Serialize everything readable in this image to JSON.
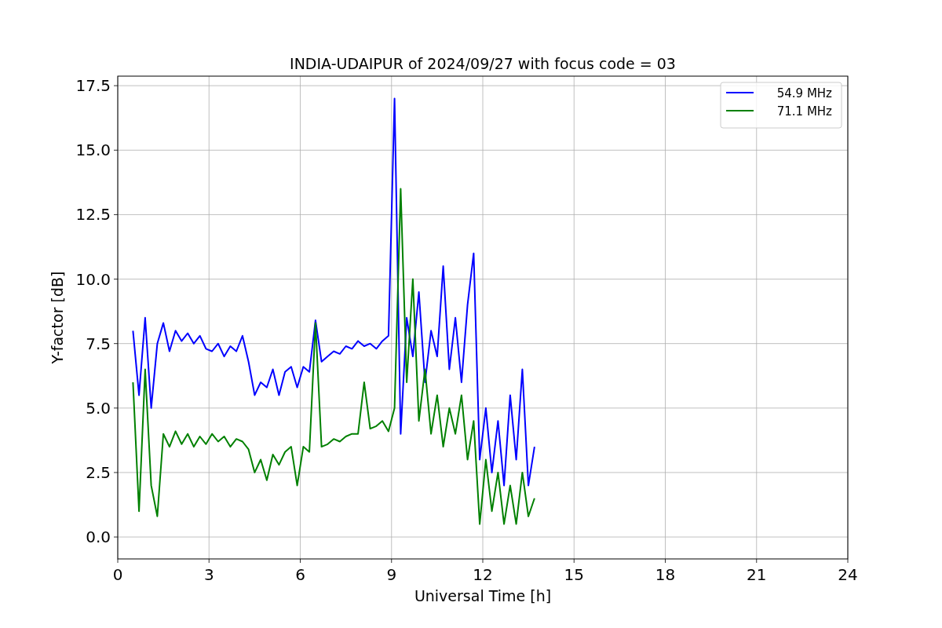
{
  "chart_data": {
    "type": "line",
    "title": "INDIA-UDAIPUR of 2024/09/27 with focus code = 03",
    "xlabel": "Universal Time [h]",
    "ylabel": "Y-factor [dB]",
    "x": [
      0.5,
      0.7,
      0.9,
      1.1,
      1.3,
      1.5,
      1.7,
      1.9,
      2.1,
      2.3,
      2.5,
      2.7,
      2.9,
      3.1,
      3.3,
      3.5,
      3.7,
      3.9,
      4.1,
      4.3,
      4.5,
      4.7,
      4.9,
      5.1,
      5.3,
      5.5,
      5.7,
      5.9,
      6.1,
      6.3,
      6.5,
      6.7,
      6.9,
      7.1,
      7.3,
      7.5,
      7.7,
      7.9,
      8.1,
      8.3,
      8.5,
      8.7,
      8.9,
      9.1,
      9.3,
      9.5,
      9.7,
      9.9,
      10.1,
      10.3,
      10.5,
      10.7,
      10.9,
      11.1,
      11.3,
      11.5,
      11.7,
      11.9,
      12.1,
      12.3,
      12.5,
      12.7,
      12.9,
      13.1,
      13.3,
      13.5,
      13.7
    ],
    "series": [
      {
        "name": "54.9 MHz",
        "color": "#0000ff",
        "values": [
          8.0,
          5.5,
          8.5,
          5.0,
          7.5,
          8.3,
          7.2,
          8.0,
          7.6,
          7.9,
          7.5,
          7.8,
          7.3,
          7.2,
          7.5,
          7.0,
          7.4,
          7.2,
          7.8,
          6.8,
          5.5,
          6.0,
          5.8,
          6.5,
          5.5,
          6.4,
          6.6,
          5.8,
          6.6,
          6.4,
          8.4,
          6.8,
          7.0,
          7.2,
          7.1,
          7.4,
          7.3,
          7.6,
          7.4,
          7.5,
          7.3,
          7.6,
          7.8,
          17.0,
          4.0,
          8.5,
          7.0,
          9.5,
          6.0,
          8.0,
          7.0,
          10.5,
          6.5,
          8.5,
          6.0,
          9.0,
          11.0,
          3.0,
          5.0,
          2.5,
          4.5,
          2.0,
          5.5,
          3.0,
          6.5,
          2.0,
          3.5
        ]
      },
      {
        "name": "71.1 MHz",
        "color": "#008000",
        "values": [
          6.0,
          1.0,
          6.5,
          2.0,
          0.8,
          4.0,
          3.5,
          4.1,
          3.6,
          4.0,
          3.5,
          3.9,
          3.6,
          4.0,
          3.7,
          3.9,
          3.5,
          3.8,
          3.7,
          3.4,
          2.5,
          3.0,
          2.2,
          3.2,
          2.8,
          3.3,
          3.5,
          2.0,
          3.5,
          3.3,
          8.3,
          3.5,
          3.6,
          3.8,
          3.7,
          3.9,
          4.0,
          4.0,
          6.0,
          4.2,
          4.3,
          4.5,
          4.1,
          5.0,
          13.5,
          6.0,
          10.0,
          4.5,
          6.5,
          4.0,
          5.5,
          3.5,
          5.0,
          4.0,
          5.5,
          3.0,
          4.5,
          0.5,
          3.0,
          1.0,
          2.5,
          0.5,
          2.0,
          0.5,
          2.5,
          0.8,
          1.5
        ]
      }
    ],
    "grid": true,
    "legend": true,
    "xlim": [
      0,
      24
    ],
    "ylim": [
      -0.85,
      17.87
    ],
    "xticks": [
      0,
      3,
      6,
      9,
      12,
      15,
      18,
      21,
      24
    ],
    "yticks": [
      {
        "value": 0,
        "label": "0.0"
      },
      {
        "value": 2.5,
        "label": "2.5"
      },
      {
        "value": 5,
        "label": "5.0"
      },
      {
        "value": 7.5,
        "label": "7.5"
      },
      {
        "value": 10,
        "label": "10.0"
      },
      {
        "value": 12.5,
        "label": "12.5"
      },
      {
        "value": 15,
        "label": "15.0"
      },
      {
        "value": 17.5,
        "label": "17.5"
      }
    ]
  }
}
